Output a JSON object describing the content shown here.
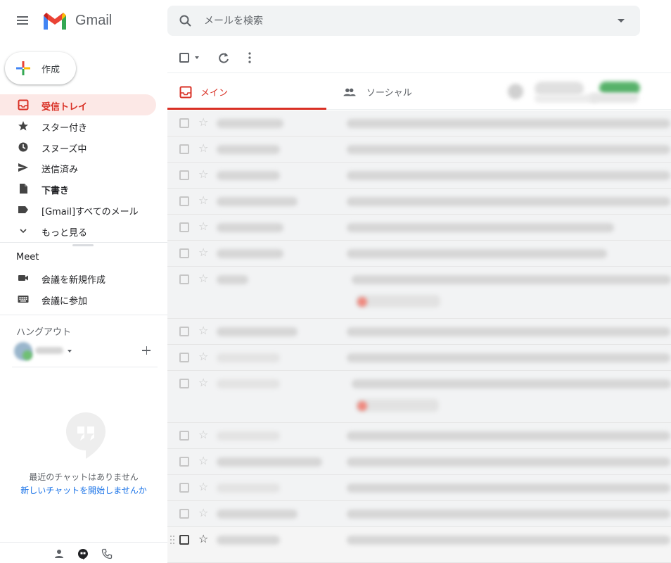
{
  "app": {
    "name": "Gmail"
  },
  "search": {
    "placeholder": "メールを検索"
  },
  "sidebar": {
    "compose_label": "作成",
    "items": [
      {
        "label": "受信トレイ",
        "icon": "inbox-icon",
        "active": true
      },
      {
        "label": "スター付き",
        "icon": "star-icon"
      },
      {
        "label": "スヌーズ中",
        "icon": "clock-icon"
      },
      {
        "label": "送信済み",
        "icon": "send-icon"
      },
      {
        "label": "下書き",
        "icon": "draft-icon",
        "bold": true
      },
      {
        "label": "[Gmail]すべてのメール",
        "icon": "label-icon"
      },
      {
        "label": "もっと見る",
        "icon": "chevron-down-icon"
      }
    ],
    "meet": {
      "title": "Meet",
      "items": [
        {
          "label": "会議を新規作成",
          "icon": "video-icon"
        },
        {
          "label": "会議に参加",
          "icon": "keyboard-icon"
        }
      ]
    },
    "hangouts": {
      "title": "ハングアウト",
      "empty_text": "最近のチャットはありません",
      "start_link": "新しいチャットを開始しませんか"
    }
  },
  "tabs": [
    {
      "label": "メイン",
      "icon": "inbox-icon",
      "active": true
    },
    {
      "label": "ソーシャル",
      "icon": "people-icon"
    },
    {
      "label": "",
      "icon": "tag-icon"
    }
  ],
  "colors": {
    "accent": "#d93025",
    "active_bg": "#fce8e6",
    "link": "#1a73e8",
    "promo_badge": "#34a853"
  },
  "email_rows": {
    "count": 16,
    "content_blurred": true
  }
}
